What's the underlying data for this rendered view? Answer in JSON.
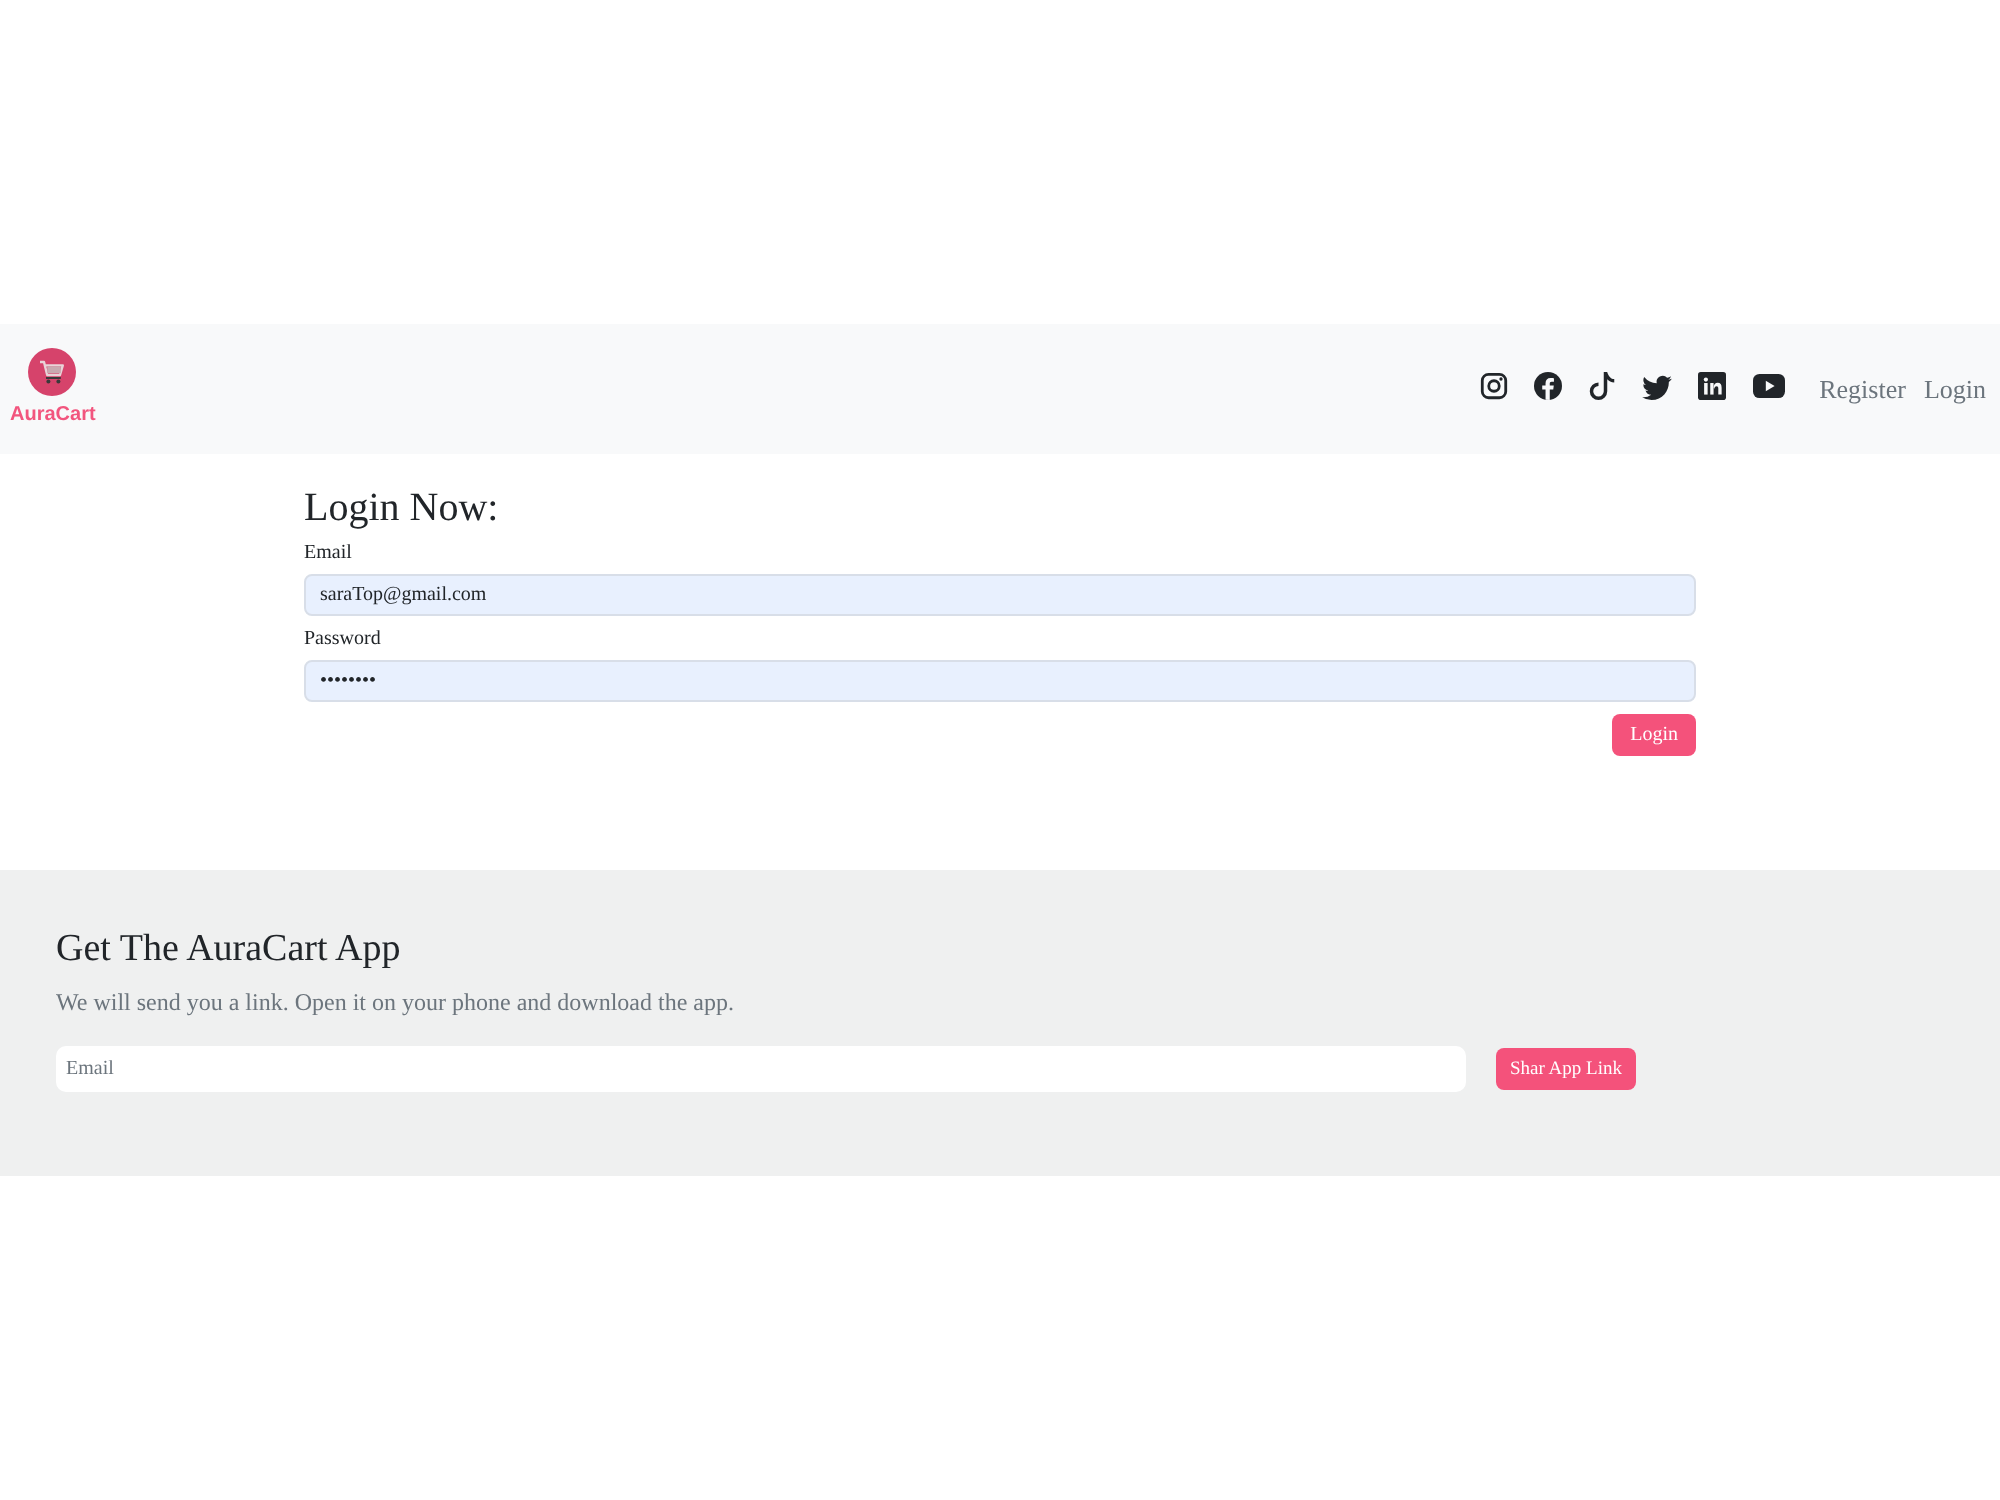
{
  "header": {
    "brand": "AuraCart",
    "nav_links": [
      {
        "label": "Register"
      },
      {
        "label": "Login"
      }
    ]
  },
  "login_form": {
    "title": "Login Now:",
    "fields": [
      {
        "label": "Email",
        "value": "saraTop@gmail.com"
      },
      {
        "label": "Password",
        "value": "••••••••"
      }
    ],
    "submit_button": "Login"
  },
  "app_promo": {
    "title": "Get The AuraCart App",
    "text": "We will send you a link. Open it on your phone and download the app.",
    "email_field": {
      "placeholder": "Email"
    },
    "button": "Shar App Link"
  }
}
